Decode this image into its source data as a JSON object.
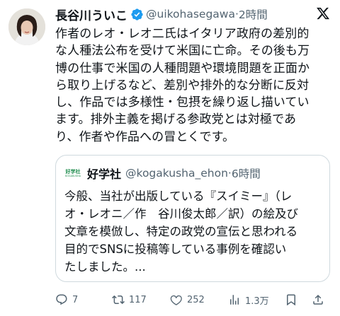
{
  "post": {
    "author_name": "長谷川ういこ",
    "handle": "@uikohasegawa",
    "separator": "·",
    "time": "2時間",
    "text_lines": [
      "作者のレオ・レオ二氏はイタリア政府の差別的",
      "な人種法公布を受けて米国に亡命。その後も万",
      "博の仕事で米国の人種問題や環境問題を正面か",
      "ら取り上げるなど、差別や排外的な分断に反対",
      "し、作品では多様性・包摂を繰り返し描いてい",
      "ます。排外主義を掲げる参政党とは対極であ",
      "り、作者や作品への冒とくです。"
    ]
  },
  "quote": {
    "avatar_text": "好学社",
    "avatar_subtext": "KOGAKUSHA",
    "author_name": "好学社",
    "handle": "@kogakusha_ehon",
    "separator": "·",
    "time": "6時間",
    "text_lines": [
      "今般、当社が出版している『スイミー』（レ",
      "オ・レオニ／作　谷川俊太郎／訳）の絵及び",
      "文章を模倣し、特定の政党の宣伝と思われる",
      "目的でSNSに投稿等している事例を確認い",
      "たしました。..."
    ]
  },
  "actions": {
    "replies": "7",
    "reposts": "117",
    "likes": "252",
    "views": "1.3万"
  },
  "colors": {
    "text": "#0f1419",
    "secondary": "#536471",
    "verified": "#1d9bf0",
    "border": "#cfd9de"
  },
  "icons": [
    "verified-badge-icon",
    "x-logo-icon",
    "reply-icon",
    "repost-icon",
    "like-icon",
    "views-icon",
    "bookmark-icon",
    "share-icon"
  ]
}
